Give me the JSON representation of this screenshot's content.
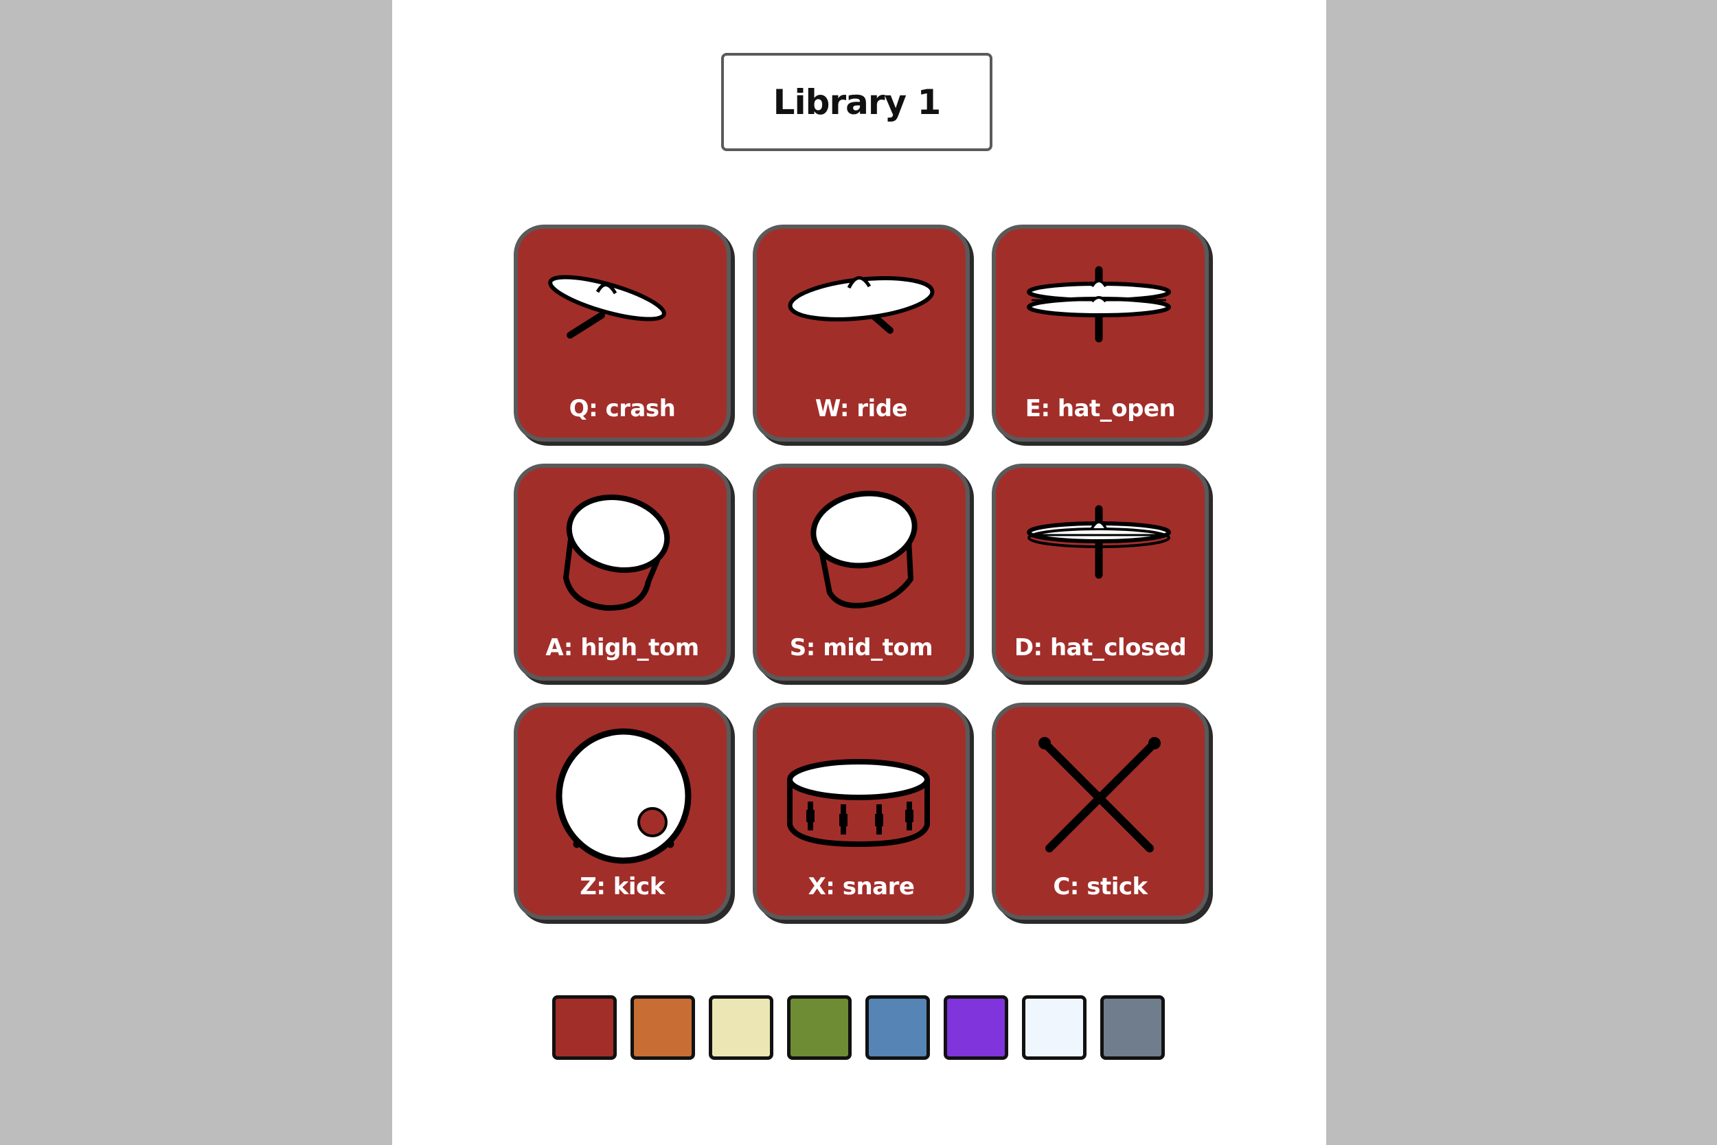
{
  "library": {
    "title": "Library 1"
  },
  "pad_color": "#a22e2a",
  "pads": [
    {
      "key": "Q",
      "sound": "crash",
      "label": "Q: crash",
      "icon": "crash-cymbal-icon"
    },
    {
      "key": "W",
      "sound": "ride",
      "label": "W: ride",
      "icon": "ride-cymbal-icon"
    },
    {
      "key": "E",
      "sound": "hat_open",
      "label": "E: hat_open",
      "icon": "hihat-open-icon"
    },
    {
      "key": "A",
      "sound": "high_tom",
      "label": "A: high_tom",
      "icon": "tom-drum-icon"
    },
    {
      "key": "S",
      "sound": "mid_tom",
      "label": "S: mid_tom",
      "icon": "tom-drum-icon"
    },
    {
      "key": "D",
      "sound": "hat_closed",
      "label": "D: hat_closed",
      "icon": "hihat-closed-icon"
    },
    {
      "key": "Z",
      "sound": "kick",
      "label": "Z: kick",
      "icon": "kick-drum-icon"
    },
    {
      "key": "X",
      "sound": "snare",
      "label": "X: snare",
      "icon": "snare-drum-icon"
    },
    {
      "key": "C",
      "sound": "stick",
      "label": "C: stick",
      "icon": "drumsticks-icon"
    }
  ],
  "swatches": [
    "#a22e2a",
    "#c86e34",
    "#ebe6b4",
    "#6d8c33",
    "#5584b5",
    "#8034dc",
    "#f0f6fd",
    "#707d8c"
  ]
}
